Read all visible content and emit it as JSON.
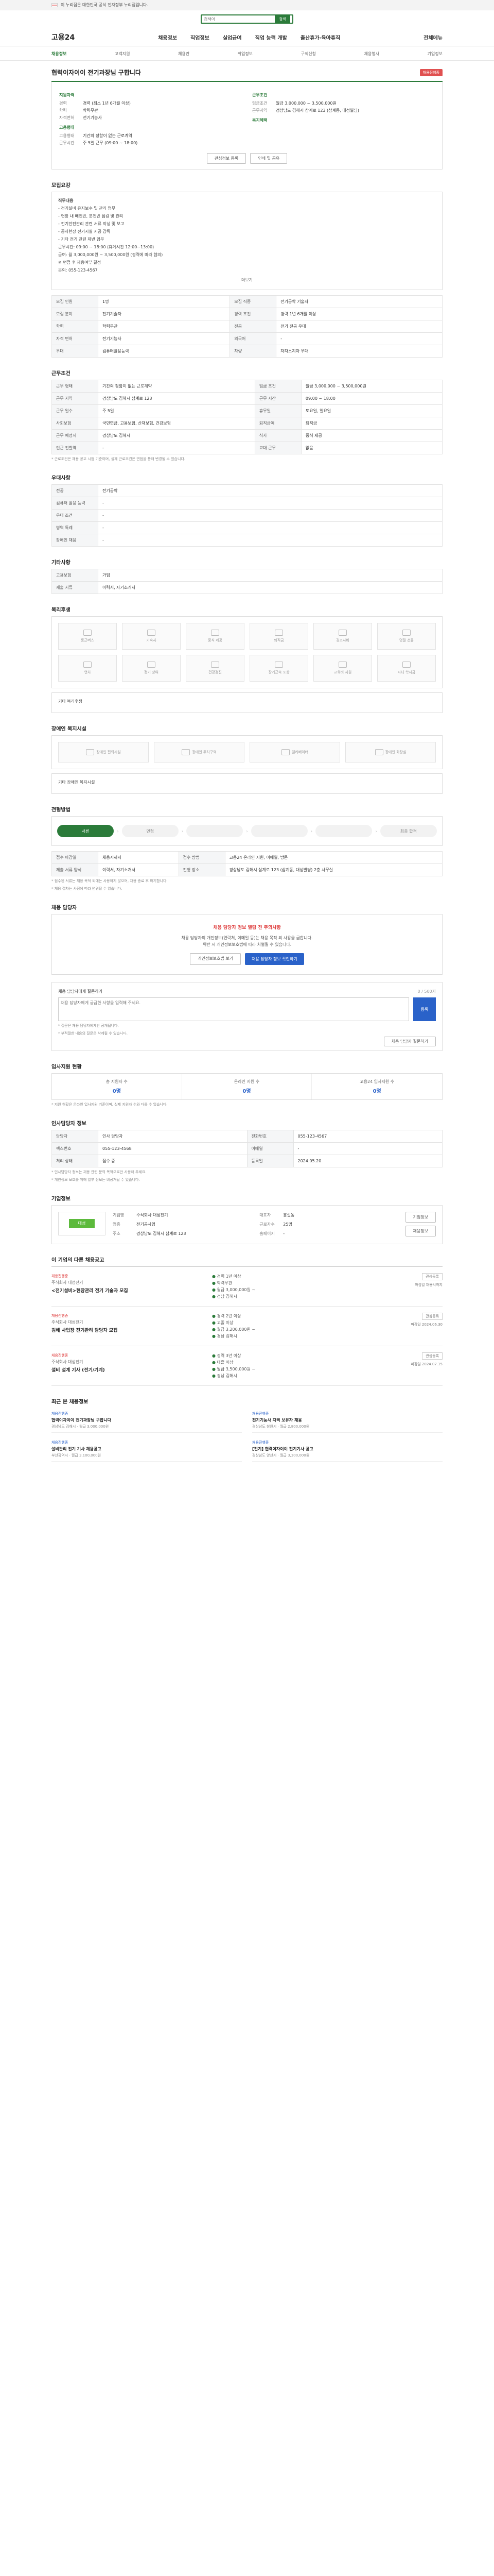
{
  "gov_bar": {
    "text": "이 누리집은 대한민국 공식 전자정부 누리집입니다."
  },
  "search": {
    "placeholder": "검색어",
    "button": "검색"
  },
  "gnb": {
    "logo": "고용24",
    "menu": [
      "채용정보",
      "직업정보",
      "실업급여",
      "직업 능력 개발",
      "출산휴가·육아휴직"
    ],
    "right": "전체메뉴"
  },
  "sub_tabs": [
    "채용정보",
    "고객지원",
    "채용관",
    "취업정보",
    "구직신청",
    "채용행사",
    "기업정보"
  ],
  "job": {
    "title": "협력이자이이 전기과장님 구합니다",
    "badge": "채용진행중",
    "wage_label": "임금조건",
    "wage_value": "월급 3,000,000 ~ 3,500,000원",
    "area_label": "근무지역",
    "area_value": "경상남도 김해시 삼계로 123 (삼계동, 대성빌딩)",
    "exp_label": "경력",
    "exp_value": "경력 (최소 1년 6개월 이상)",
    "edu_label": "학력",
    "edu_value": "학력무관",
    "qual_label": "자격면허",
    "qual_value": "전기기능사",
    "type_label": "고용형태",
    "type_value": "기간의 정함이 없는 근로계약",
    "hours_label": "근무시간",
    "hours_value": "주 5일 근무 (09:00 ~ 18:00)",
    "left_head": "지원자격",
    "right_head": "근무조건",
    "right_head2": "복지혜택",
    "btn_fav": "관심정보 등록",
    "btn_print": "인쇄 및 공유"
  },
  "sec": {
    "recruit": "모집요강",
    "detail": "직무내용",
    "conditions": "근무조건",
    "prefer": "우대사항",
    "other": "기타사항",
    "welfare": "복리후생",
    "disabled": "장애인 복지시설",
    "process": "전형방법",
    "apply": "채용 담당자",
    "apply2": "입사지원 현황",
    "contact": "인사담당자 정보",
    "company": "기업정보",
    "similar": "이 기업의 다른 채용공고",
    "recent": "최근 본 채용정보"
  },
  "detail_box": [
    "직무내용",
    "- 전기설비 유지보수 및 관리 업무",
    "- 현장 내 배전반, 분전반 점검 및 관리",
    "- 전기안전관리 관련 서류 작성 및 보고",
    "- 공사현장 전기시설 시공 감독",
    "- 기타 전기 관련 제반 업무",
    "근무시간: 09:00 ~ 18:00 (휴게시간 12:00~13:00)",
    "급여: 월 3,000,000원 ~ 3,500,000원 (경력에 따라 협의)",
    "※ 면접 후 채용여부 결정",
    "문의: 055-123-4567"
  ],
  "more": "더보기",
  "recruit_table": {
    "rows": [
      [
        "모집 인원",
        "1명",
        "모집 직종",
        "전기공학 기술자"
      ],
      [
        "모집 분야",
        "전기기술자",
        "경력 조건",
        "경력 1년 6개월 이상"
      ],
      [
        "학력",
        "학력무관",
        "전공",
        "전기 전공 우대"
      ],
      [
        "자격 면허",
        "전기기능사",
        "외국어",
        "-"
      ],
      [
        "우대",
        "컴퓨터활용능력",
        "차량",
        "자차소지자 우대"
      ]
    ]
  },
  "cond_table": {
    "rows": [
      [
        "근무 형태",
        "기간의 정함이 없는 근로계약",
        "임금 조건",
        "월급 3,000,000 ~ 3,500,000원"
      ],
      [
        "근무 지역",
        "경상남도 김해시 삼계로 123",
        "근무 시간",
        "09:00 ~ 18:00"
      ],
      [
        "근무 일수",
        "주 5일",
        "휴무일",
        "토요일, 일요일"
      ],
      [
        "사회보험",
        "국민연금, 고용보험, 산재보험, 건강보험",
        "퇴직급여",
        "퇴직금"
      ],
      [
        "근무 예정지",
        "경상남도 김해시",
        "식사",
        "중식 제공"
      ],
      [
        "인근 전철역",
        "-",
        "교대 근무",
        "없음"
      ]
    ]
  },
  "cond_note": "* 근로조건은 채용 공고 시점 기준이며, 실제 근로조건은 면접을 통해 변경될 수 있습니다.",
  "prefer_table": {
    "rows": [
      [
        "전공",
        "전기공학"
      ],
      [
        "컴퓨터 활용 능력",
        "-"
      ],
      [
        "우대 조건",
        "-"
      ],
      [
        "병역 특례",
        "-"
      ],
      [
        "장애인 채용",
        "-"
      ]
    ]
  },
  "other_table": {
    "rows": [
      [
        "고용보험",
        "가입"
      ],
      [
        "제출 서류",
        "이력서, 자기소개서"
      ]
    ]
  },
  "welfare_items": [
    "통근버스",
    "기숙사",
    "중식 제공",
    "퇴직금",
    "경조사비",
    "명절 선물",
    "연차",
    "정기 상여",
    "건강검진",
    "장기근속 포상",
    "교육비 지원",
    "자녀 학자금"
  ],
  "welfare_note": "기타 복리후생",
  "disabled_items": [
    "장애인 편의시설",
    "장애인 주차구역",
    "엘리베이터",
    "장애인 화장실"
  ],
  "disabled_note": "기타 장애인 복지시설",
  "steps": [
    "서류",
    "면접",
    "",
    "",
    "",
    "최종 합격"
  ],
  "process_table": {
    "rows": [
      [
        "접수 마감일",
        "채용시까지",
        "접수 방법",
        "고용24 온라인 지원, 이메일, 방문"
      ],
      [
        "제출 서류 양식",
        "이력서, 자기소개서",
        "전형 장소",
        "경상남도 김해시 삼계로 123 (삼계동, 대성빌딩) 2층 사무실"
      ]
    ]
  },
  "process_notes": [
    "* 접수된 서류는 채용 목적 외에는 사용하지 않으며, 채용 종료 후 파기합니다.",
    "* 채용 절차는 사정에 따라 변경될 수 있습니다."
  ],
  "apply_box": {
    "warn": "채용 담당자 정보 열람 전 주의사항",
    "text1": "채용 담당자의 개인정보(연락처, 이메일 등)는 채용 목적 외 사용을 금합니다.",
    "text2": "위반 시 개인정보보호법에 따라 처벌될 수 있습니다.",
    "btn1": "개인정보보호법 보기",
    "btn2": "채용 담당자 정보 확인하기"
  },
  "qa": {
    "title": "채용 담당자에게 질문하기",
    "placeholder": "채용 담당자에게 궁금한 사항을 입력해 주세요.",
    "send": "등록",
    "count": "0 / 500자"
  },
  "qa_notes": [
    "* 질문은 채용 담당자에게만 공개됩니다.",
    "* 부적절한 내용의 질문은 삭제될 수 있습니다."
  ],
  "qa_btn": "채용 담당자 질문하기",
  "stats": [
    {
      "label": "총 지원자 수",
      "value": "0명"
    },
    {
      "label": "온라인 지원 수",
      "value": "0명"
    },
    {
      "label": "고용24 입사지원 수",
      "value": "0명"
    }
  ],
  "stats_note": "* 지원 현황은 온라인 입사지원 기준이며, 실제 지원자 수와 다를 수 있습니다.",
  "contact_table": {
    "rows": [
      [
        "담당자",
        "인사 담당자",
        "전화번호",
        "055-123-4567"
      ],
      [
        "팩스번호",
        "055-123-4568",
        "이메일",
        "-"
      ],
      [
        "처리 상태",
        "접수 중",
        "등록일",
        "2024.05.20"
      ]
    ]
  },
  "contact_notes": [
    "* 인사담당자 정보는 채용 관련 문의 목적으로만 사용해 주세요.",
    "* 개인정보 보호를 위해 일부 정보는 비공개될 수 있습니다."
  ],
  "company": {
    "logo_text": "대성",
    "name_label": "기업명",
    "name": "주식회사 대성전기",
    "ceo_label": "대표자",
    "ceo": "홍길동",
    "biz_label": "업종",
    "biz": "전기공사업",
    "emp_label": "근로자수",
    "emp": "25명",
    "addr_label": "주소",
    "addr": "경상남도 김해시 삼계로 123",
    "home_label": "홈페이지",
    "home": "-",
    "btn1": "기업정보",
    "btn2": "채용정보"
  },
  "similar_jobs": [
    {
      "tag": "채용진행중",
      "company": "주식회사 대성전기",
      "title": "<전기설비>현장관리 전기 기술자 모집",
      "mid": [
        "경력 1년 이상",
        "학력무관",
        "월급 3,000,000원 ~",
        "경남 김해시"
      ],
      "right": [
        "관심등록",
        "마감일 채용시까지"
      ]
    },
    {
      "tag": "채용진행중",
      "company": "주식회사 대성전기",
      "title": "김해 사업장 전기관리 담당자 모집",
      "mid": [
        "경력 2년 이상",
        "고졸 이상",
        "월급 3,200,000원 ~",
        "경남 김해시"
      ],
      "right": [
        "관심등록",
        "마감일 2024.06.30"
      ]
    },
    {
      "tag": "채용진행중",
      "company": "주식회사 대성전기",
      "title": "설비 설계 기사 (전기/기계)",
      "mid": [
        "경력 3년 이상",
        "대졸 이상",
        "월급 3,500,000원 ~",
        "경남 김해시"
      ],
      "right": [
        "관심등록",
        "마감일 2024.07.15"
      ]
    }
  ],
  "recent_jobs": [
    {
      "tag": "채용진행중",
      "title": "협력이자이이 전기과장님 구합니다",
      "meta": "경상남도 김해시 · 월급 3,000,000원"
    },
    {
      "tag": "채용진행중",
      "title": "전기기능사 자격 보유자 채용",
      "meta": "경상남도 창원시 · 월급 2,800,000원"
    },
    {
      "tag": "채용진행중",
      "title": "설비관리 전기 기사 채용공고",
      "meta": "부산광역시 · 월급 3,100,000원"
    },
    {
      "tag": "채용진행중",
      "title": "[전기] 협력이자이이 전기기사 공고",
      "meta": "경상남도 양산시 · 월급 3,300,000원"
    }
  ]
}
